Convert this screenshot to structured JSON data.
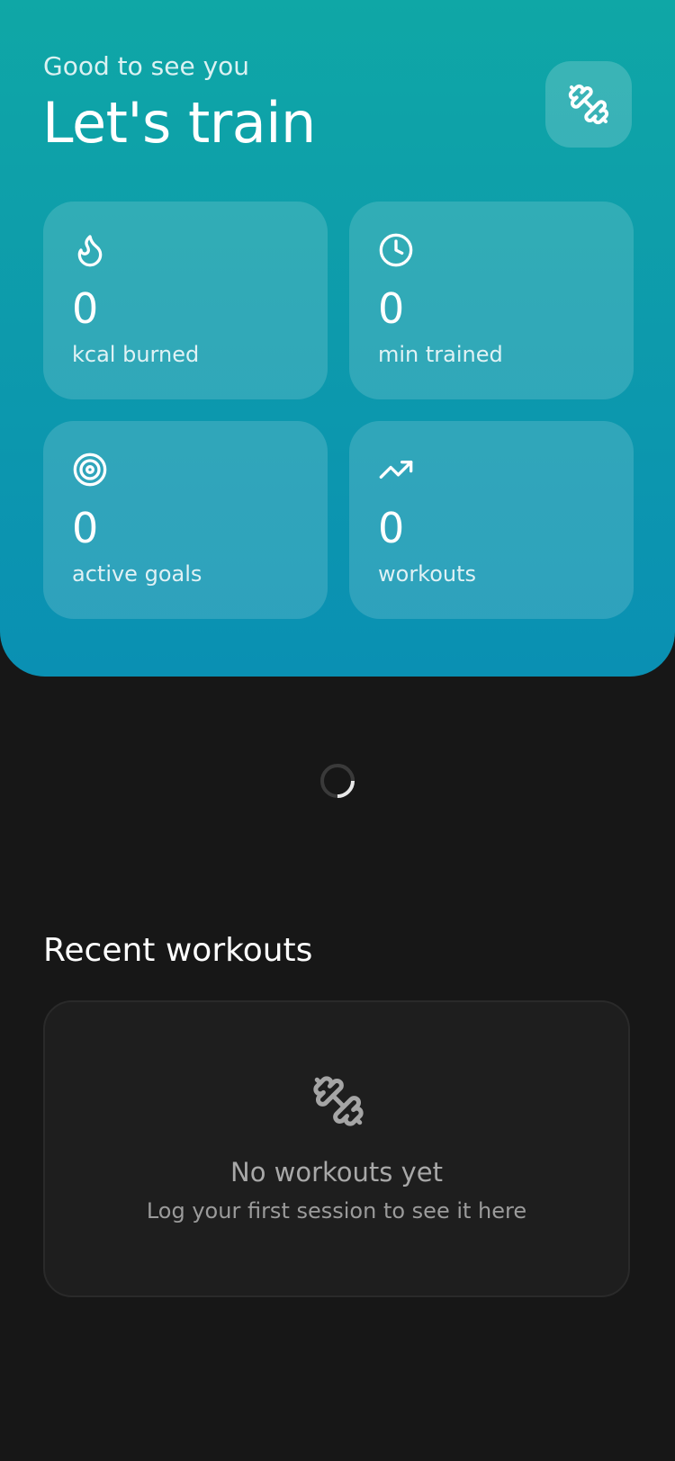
{
  "header": {
    "greeting": "Good to see you",
    "title": "Let's train",
    "action_icon": "dumbbell-icon"
  },
  "stats": [
    {
      "icon": "flame-icon",
      "value": "0",
      "label": "kcal burned"
    },
    {
      "icon": "clock-icon",
      "value": "0",
      "label": "min trained"
    },
    {
      "icon": "target-icon",
      "value": "0",
      "label": "active goals"
    },
    {
      "icon": "trending-up-icon",
      "value": "0",
      "label": "workouts"
    }
  ],
  "loading": {
    "icon": "loading-spinner"
  },
  "recent": {
    "title": "Recent workouts",
    "empty_icon": "dumbbell-icon",
    "empty_title": "No workouts yet",
    "empty_subtitle": "Log your first session to see it here"
  },
  "colors": {
    "hero_top": "#0fa7a6",
    "hero_bottom": "#0a90b3",
    "background": "#171717",
    "card": "#1e1e1e"
  }
}
